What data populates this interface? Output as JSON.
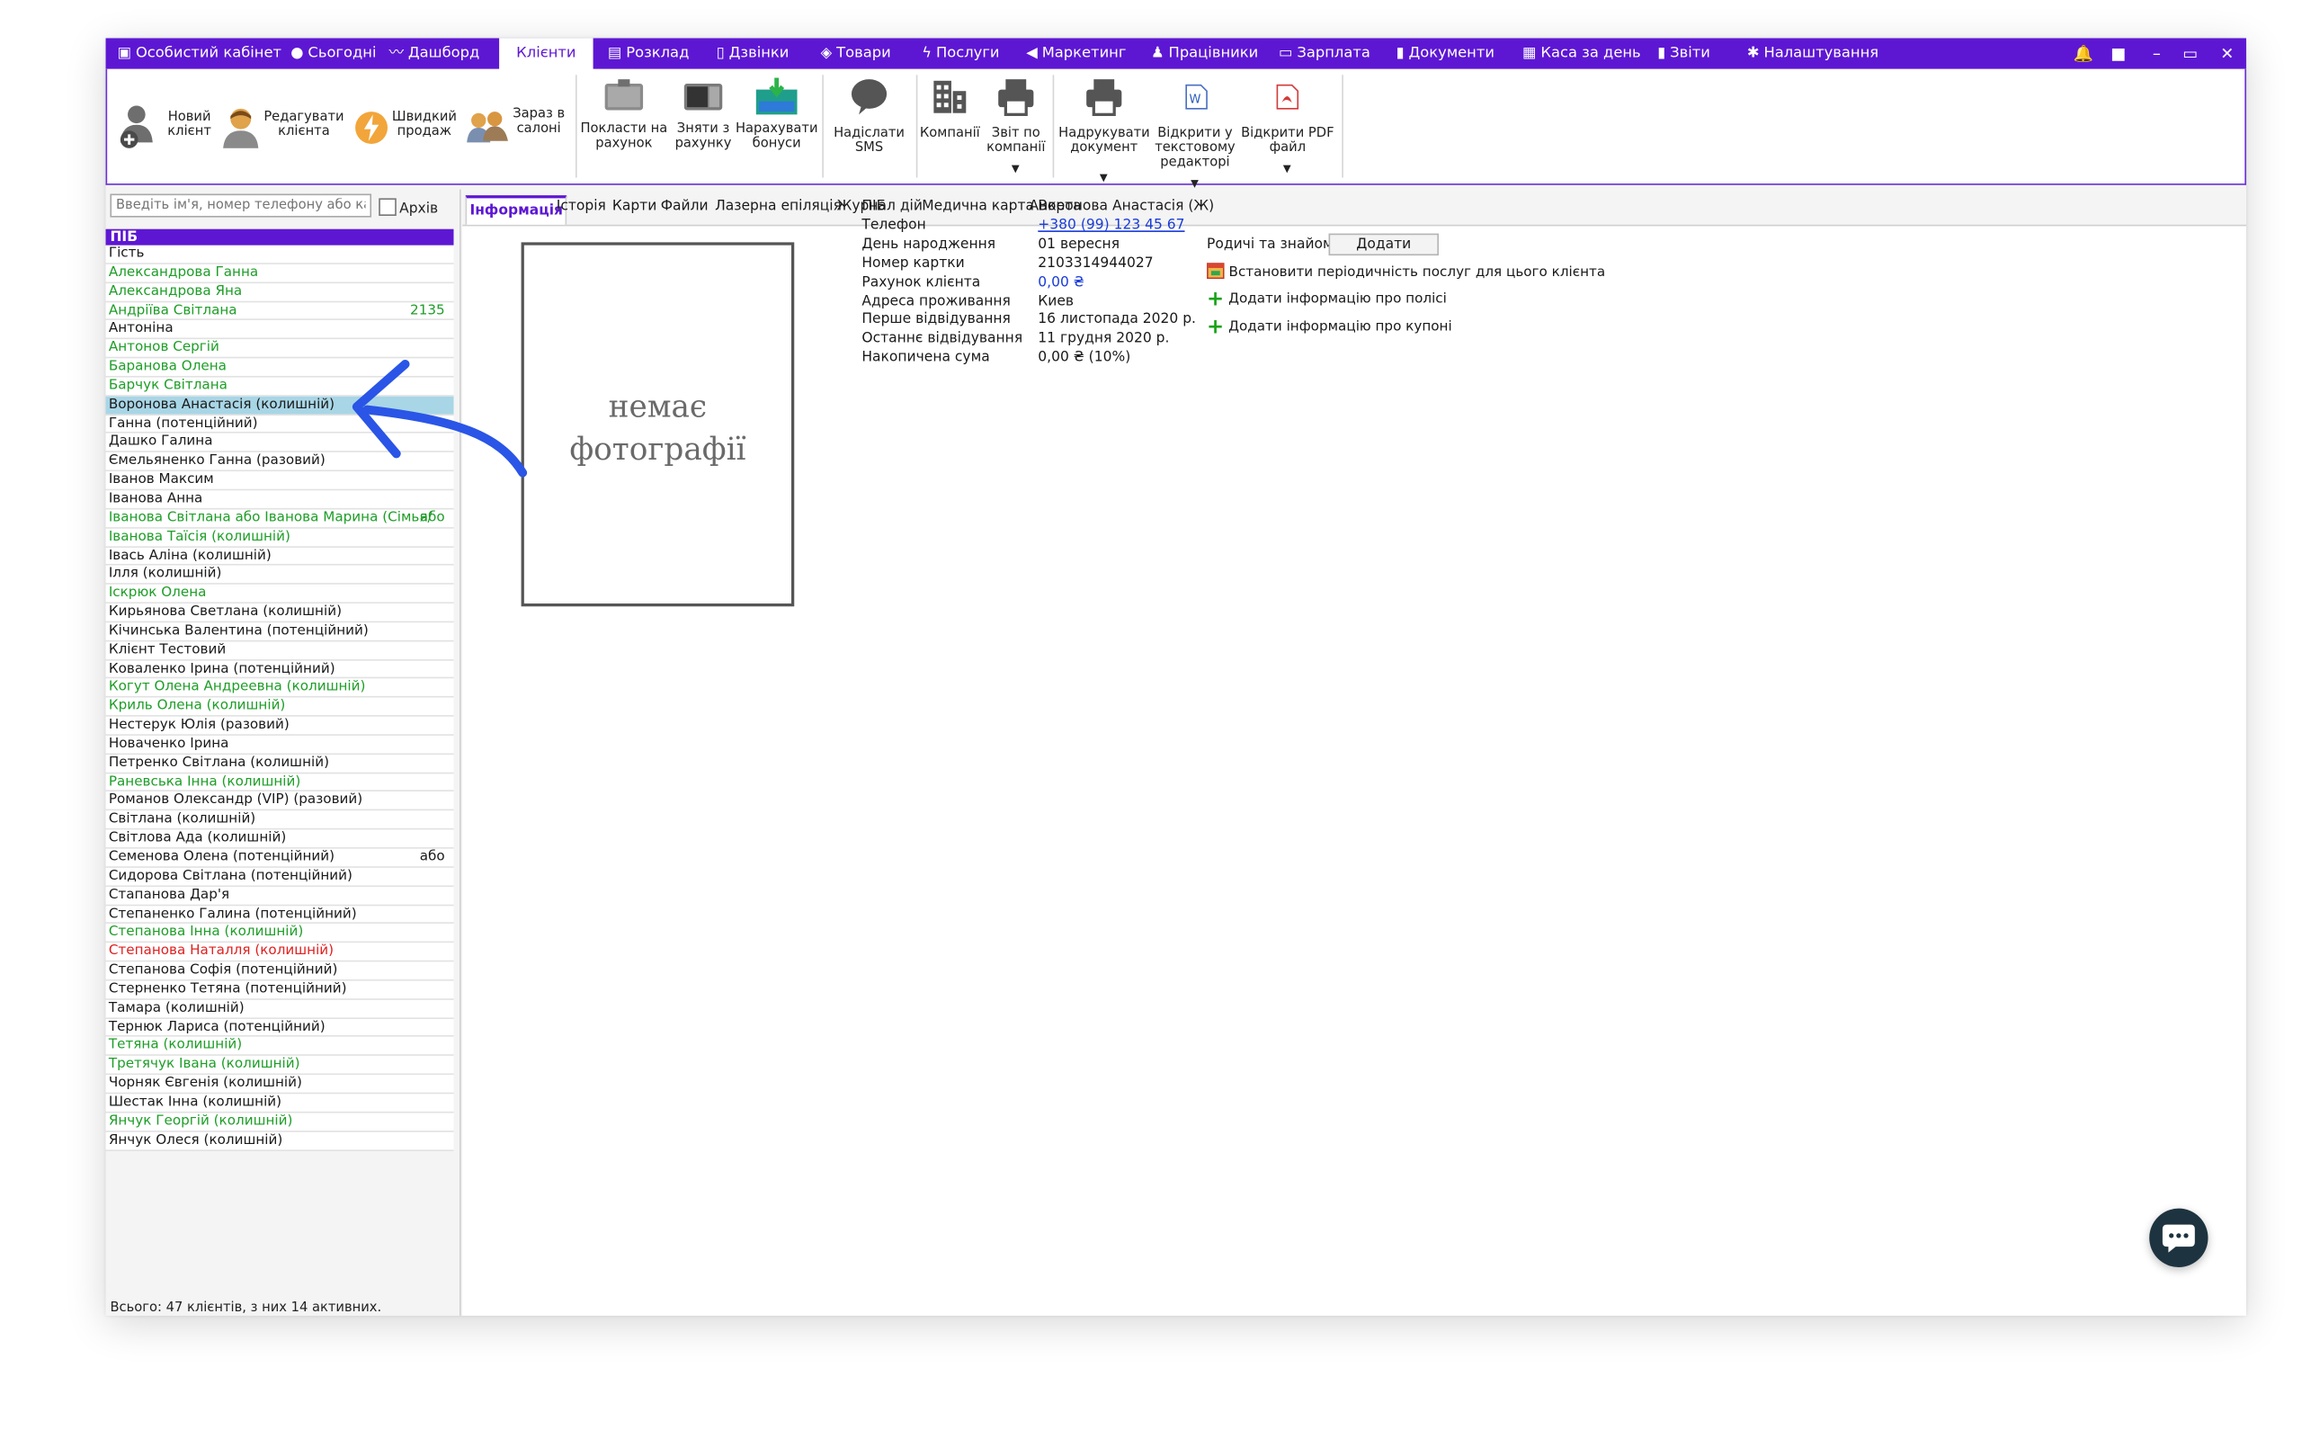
{
  "menubar": {
    "tabs": [
      {
        "label": "Особистий кабінет",
        "icon": "briefcase-icon"
      },
      {
        "label": "Сьогодні",
        "icon": "clock-icon"
      },
      {
        "label": "Дашборд",
        "icon": "pulse-icon"
      },
      {
        "label": "Клієнти",
        "icon": "",
        "active": true
      },
      {
        "label": "Розклад",
        "icon": "calendar-icon"
      },
      {
        "label": "Дзвінки",
        "icon": "phone-icon"
      },
      {
        "label": "Товари",
        "icon": "box-icon"
      },
      {
        "label": "Послуги",
        "icon": "lightning-icon"
      },
      {
        "label": "Маркетинг",
        "icon": "megaphone-icon"
      },
      {
        "label": "Працівники",
        "icon": "person-icon"
      },
      {
        "label": "Зарплата",
        "icon": "money-icon"
      },
      {
        "label": "Документи",
        "icon": "document-icon"
      },
      {
        "label": "Каса за день",
        "icon": "calculator-icon"
      },
      {
        "label": "Звіти",
        "icon": "bar-chart-icon"
      },
      {
        "label": "Налаштування",
        "icon": "gear-icon"
      }
    ],
    "window_controls": [
      "bell-icon",
      "lock-icon",
      "minimize-icon",
      "restore-icon",
      "close-icon"
    ]
  },
  "ribbon": {
    "new_client": "Новий клієнт",
    "edit_client": "Редагувати клієнта",
    "quick_sale": "Швидкий продаж",
    "in_salon": "Зараз в салоні",
    "deposit": "Покласти на рахунок",
    "withdraw": "Зняти з рахунку",
    "bonuses": "Нарахувати бонуси",
    "send_sms": "Надіслати SMS",
    "companies": "Компанії",
    "company_report": "Звіт по компанії",
    "print_doc": "Надрукувати документ",
    "open_text_editor": "Відкрити у текстовому редакторі",
    "open_pdf": "Відкрити PDF файл"
  },
  "search": {
    "placeholder": "Введіть ім'я, номер телефону або кар...",
    "archive_label": "Архів"
  },
  "client_list": {
    "header": "ПІБ",
    "rows": [
      {
        "name": "Гість",
        "color": "black",
        "extra": ""
      },
      {
        "name": "Александрова Ганна",
        "color": "green",
        "extra": ""
      },
      {
        "name": "Александрова Яна",
        "color": "green",
        "extra": ""
      },
      {
        "name": "Андріїва Світлана",
        "color": "green",
        "extra": "2135"
      },
      {
        "name": "Антоніна",
        "color": "black",
        "extra": ""
      },
      {
        "name": "Антонов Сергій",
        "color": "green",
        "extra": ""
      },
      {
        "name": "Баранова Олена",
        "color": "green",
        "extra": ""
      },
      {
        "name": "Барчук Світлана",
        "color": "green",
        "extra": ""
      },
      {
        "name": "Воронова Анастасія (колишній)",
        "color": "black",
        "extra": "",
        "selected": true
      },
      {
        "name": "Ганна (потенційний)",
        "color": "black",
        "extra": ""
      },
      {
        "name": "Дашко Галина",
        "color": "black",
        "extra": ""
      },
      {
        "name": "Ємельяненко Ганна (разовий)",
        "color": "black",
        "extra": ""
      },
      {
        "name": "Іванов Максим",
        "color": "black",
        "extra": ""
      },
      {
        "name": "Іванова Анна",
        "color": "black",
        "extra": ""
      },
      {
        "name": "Іванова Світлана або Іванова Марина (Сімья/",
        "color": "green",
        "extra": "або"
      },
      {
        "name": "Іванова Таїсія (колишній)",
        "color": "green",
        "extra": ""
      },
      {
        "name": "Івась Аліна (колишній)",
        "color": "black",
        "extra": ""
      },
      {
        "name": "Ілля (колишній)",
        "color": "black",
        "extra": ""
      },
      {
        "name": "Іскрюк Олена",
        "color": "green",
        "extra": ""
      },
      {
        "name": "Кирьянова Светлана (колишній)",
        "color": "black",
        "extra": ""
      },
      {
        "name": "Кічинська Валентина (потенційний)",
        "color": "black",
        "extra": ""
      },
      {
        "name": "Клієнт Тестовий",
        "color": "black",
        "extra": ""
      },
      {
        "name": "Коваленко Ірина (потенційний)",
        "color": "black",
        "extra": ""
      },
      {
        "name": "Когут Олена Андреевна (колишній)",
        "color": "green",
        "extra": ""
      },
      {
        "name": "Криль Олена (колишній)",
        "color": "green",
        "extra": ""
      },
      {
        "name": "Нестерук Юлія (разовий)",
        "color": "black",
        "extra": ""
      },
      {
        "name": "Новаченко Ірина",
        "color": "black",
        "extra": ""
      },
      {
        "name": "Петренко Світлана (колишній)",
        "color": "black",
        "extra": ""
      },
      {
        "name": "Раневська Інна (колишній)",
        "color": "green",
        "extra": ""
      },
      {
        "name": "Романов Олександр (VIP) (разовий)",
        "color": "black",
        "extra": ""
      },
      {
        "name": "Світлана (колишній)",
        "color": "black",
        "extra": ""
      },
      {
        "name": "Світлова Ада (колишній)",
        "color": "black",
        "extra": ""
      },
      {
        "name": "Семенова Олена (потенційний)",
        "color": "black",
        "extra": "або"
      },
      {
        "name": "Сидорова Світлана (потенційний)",
        "color": "black",
        "extra": ""
      },
      {
        "name": "Стапанова Дар'я",
        "color": "black",
        "extra": ""
      },
      {
        "name": "Степаненко Галина (потенційний)",
        "color": "black",
        "extra": ""
      },
      {
        "name": "Степанова Інна (колишній)",
        "color": "green",
        "extra": ""
      },
      {
        "name": "Степанова Наталля (колишній)",
        "color": "red",
        "extra": ""
      },
      {
        "name": "Степанова Софія (потенційний)",
        "color": "black",
        "extra": ""
      },
      {
        "name": "Стерненко Тетяна (потенційний)",
        "color": "black",
        "extra": ""
      },
      {
        "name": "Тамара (колишній)",
        "color": "black",
        "extra": ""
      },
      {
        "name": "Тернюк Лариса (потенційний)",
        "color": "black",
        "extra": ""
      },
      {
        "name": "Тетяна (колишній)",
        "color": "green",
        "extra": ""
      },
      {
        "name": "Третячук Івана (колишній)",
        "color": "green",
        "extra": ""
      },
      {
        "name": "Чорняк Євгенія (колишній)",
        "color": "black",
        "extra": ""
      },
      {
        "name": "Шестак Інна (колишній)",
        "color": "black",
        "extra": ""
      },
      {
        "name": "Янчук Георгій (колишній)",
        "color": "green",
        "extra": ""
      },
      {
        "name": "Янчук Олеся (колишній)",
        "color": "black",
        "extra": ""
      }
    ],
    "footer": "Всього: 47 клієнтів, з них 14 активних."
  },
  "detail_tabs": [
    "Інформація",
    "Історія",
    "Карти",
    "Файли",
    "Лазерна епіляція",
    "Журнал дій",
    "Медична карта",
    "Анкета"
  ],
  "photo_placeholder": {
    "line1": "немає",
    "line2": "фотографії"
  },
  "client_info": {
    "fields": [
      {
        "label": "ПІБ",
        "value": "Воронова Анастасія (Ж)",
        "style": "plain"
      },
      {
        "label": "Телефон",
        "value": "+380 (99) 123 45 67",
        "style": "link"
      },
      {
        "label": "День народження",
        "value": "01 вересня",
        "style": "plain"
      },
      {
        "label": "Номер картки",
        "value": "2103314944027",
        "style": "plain"
      },
      {
        "label": "Рахунок клієнта",
        "value": "0,00 ₴",
        "style": "blue"
      },
      {
        "label": "Адреса проживання",
        "value": "Киев",
        "style": "plain"
      },
      {
        "label": "Перше відвідування",
        "value": "16 листопада 2020 р.",
        "style": "plain"
      },
      {
        "label": "Останнє відвідування",
        "value": "11 грудня 2020 р.",
        "style": "plain"
      },
      {
        "label": "Накопичена сума",
        "value": "0,00 ₴ (10%)",
        "style": "plain"
      }
    ]
  },
  "relatives": {
    "label": "Родичі та знайомі",
    "add_button": "Додати"
  },
  "actions": {
    "periodicity": "Встановити періодичність послуг для цього клієнта",
    "add_policy": "Додати інформацію про полісі",
    "add_coupons": "Додати інформацію про купоні"
  },
  "colors": {
    "accent": "#5d17d3",
    "green_text": "#1e9e28",
    "red_text": "#e02020",
    "link": "#1a3cd8",
    "selection": "#a8d6e6",
    "annotation_arrow": "#2a55e6"
  }
}
